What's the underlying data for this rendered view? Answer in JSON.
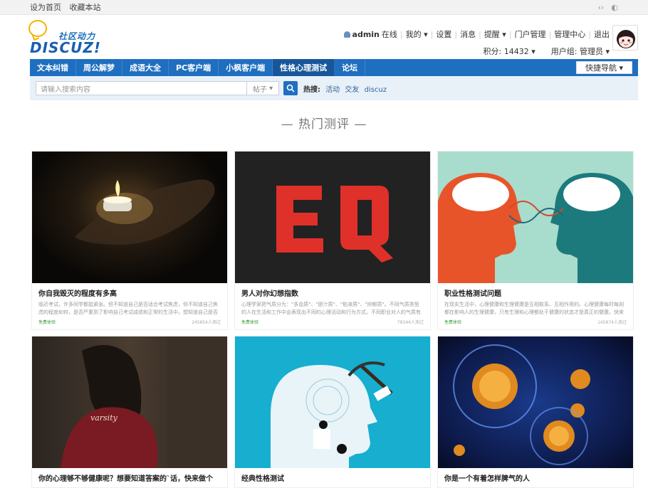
{
  "topbar": {
    "links": [
      "设为首页",
      "收藏本站"
    ]
  },
  "logo": {
    "zh": "社区动力",
    "en": "DISCUZ!"
  },
  "userbar": {
    "username": "admin",
    "status": "在线",
    "menu": [
      "我的",
      "设置",
      "消息",
      "提醒",
      "门户管理",
      "管理中心",
      "退出"
    ],
    "points": "积分: 14432",
    "group": "用户组: 管理员"
  },
  "nav": {
    "items": [
      "文本纠错",
      "周公解梦",
      "成语大全",
      "PC客户端",
      "小枫客户端",
      "性格心理测试",
      "论坛"
    ],
    "active": 5,
    "quick": "快捷导航"
  },
  "search": {
    "placeholder": "请输入搜索内容",
    "type": "帖子",
    "hot_label": "热搜:",
    "hot_keywords": [
      "活动",
      "交友",
      "discuz"
    ]
  },
  "section_title": "— 热门测评 —",
  "cards": [
    {
      "title": "你自我毁灭的程度有多高",
      "desc": "临近考试，许多同学都挺紧张。但不知道自己是否适合考试焦虑，你不知道自己焦虑的程度如何，是否严重到了影响自己考试成绩和正常的生活中。想知道自己是否患有",
      "free": "免费体验",
      "count": "245854人测过"
    },
    {
      "title": "男人对你幻想指数",
      "desc": "心理学家把气质分为：\"多血质\"、\"胆汁质\"、\"粘液质\"、\"抑郁质\"。不同气质类型的人在生活和工作中会表现出不同的心理活动和行为方式。不同职业对人的气质有特定的",
      "free": "免费体验",
      "count": "78344人测过"
    },
    {
      "title": "职业性格测试问题",
      "desc": "在现实生活中，心理健康和生理健康是互相联系、互相作用的。心理健康每时每刻都在影响人的生理健康，只有生理和心理都处于健康的状态才是真正的健康。快来对自",
      "free": "免费体验",
      "count": "145874人测过"
    },
    {
      "title": "你的心理够不够健康呢？想要知道答案的`话，快来做个",
      "desc": "",
      "free": "",
      "count": ""
    },
    {
      "title": "经典性格测试",
      "desc": "",
      "free": "",
      "count": ""
    },
    {
      "title": "你是一个有着怎样脾气的人",
      "desc": "",
      "free": "",
      "count": ""
    }
  ]
}
